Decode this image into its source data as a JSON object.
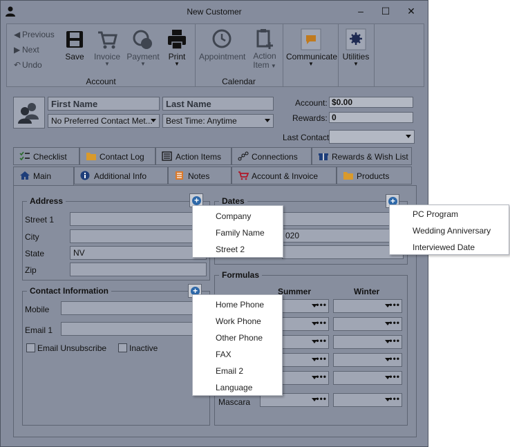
{
  "window": {
    "title": "New Customer",
    "minimize": "–",
    "maximize": "☐",
    "close": "✕"
  },
  "ribbon": {
    "nav": {
      "previous": "Previous",
      "next": "Next",
      "undo": "Undo"
    },
    "account_group": {
      "label": "Account",
      "save": "Save",
      "invoice": "Invoice",
      "payment": "Payment",
      "print": "Print"
    },
    "calendar_group": {
      "label": "Calendar",
      "appointment": "Appointment",
      "action_item_line1": "Action",
      "action_item_line2": "Item"
    },
    "communicate": "Communicate",
    "utilities": "Utilities"
  },
  "customer": {
    "first_name_placeholder": "First Name",
    "last_name_placeholder": "Last Name",
    "contact_method": "No Preferred Contact Met...",
    "best_time": "Best Time: Anytime",
    "account_label": "Account:",
    "account_value": "$0.00",
    "rewards_label": "Rewards:",
    "rewards_value": "0",
    "last_contact_label": "Last Contact",
    "last_contact_value": ""
  },
  "tabs_row1": [
    {
      "label": "Checklist",
      "icon": "checklist-icon"
    },
    {
      "label": "Contact Log",
      "icon": "folder-icon"
    },
    {
      "label": "Action Items",
      "icon": "list-icon"
    },
    {
      "label": "Connections",
      "icon": "connections-icon"
    },
    {
      "label": "Rewards & Wish List",
      "icon": "gift-icon"
    }
  ],
  "tabs_row2": [
    {
      "label": "Main",
      "icon": "home-icon"
    },
    {
      "label": "Additional Info",
      "icon": "info-icon"
    },
    {
      "label": "Notes",
      "icon": "notes-icon"
    },
    {
      "label": "Account & Invoice",
      "icon": "cart-icon"
    },
    {
      "label": "Products",
      "icon": "folder-icon"
    }
  ],
  "address": {
    "legend": "Address",
    "street1_label": "Street 1",
    "city_label": "City",
    "state_label": "State",
    "state_value": "NV",
    "zip_label": "Zip"
  },
  "contact_info": {
    "legend": "Contact Information",
    "mobile_label": "Mobile",
    "email1_label": "Email 1",
    "email_unsubscribe": "Email Unsubscribe",
    "inactive": "Inactive"
  },
  "dates": {
    "legend": "Dates",
    "partial_value": "020"
  },
  "formulas": {
    "legend": "Formulas",
    "col_summer": "Summer",
    "col_winter": "Winter",
    "row_mascara": "Mascara",
    "dots": "•••"
  },
  "menu_address": [
    "Company",
    "Family Name",
    "Street 2"
  ],
  "menu_contact": [
    "Home Phone",
    "Work Phone",
    "Other Phone",
    "FAX",
    "Email 2",
    "Language"
  ],
  "menu_dates": [
    "PC Program",
    "Wedding Anniversary",
    "Interviewed Date"
  ]
}
